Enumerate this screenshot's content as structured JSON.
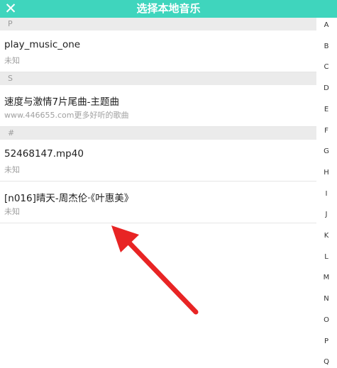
{
  "header": {
    "title": "选择本地音乐",
    "close_icon_glyph": "✕"
  },
  "sections": [
    {
      "letter": "P",
      "items": [
        {
          "title": "play_music_one",
          "subtitle": "未知"
        }
      ]
    },
    {
      "letter": "S",
      "items": [
        {
          "title": "速度与激情7片尾曲-主题曲",
          "subtitle": "www.446655.com更多好听的歌曲"
        }
      ]
    },
    {
      "letter": "#",
      "items": [
        {
          "title": "52468147.mp40",
          "subtitle": "未知"
        },
        {
          "title": "[n016]晴天-周杰伦·《叶惠美》",
          "subtitle": "未知"
        }
      ]
    }
  ],
  "index_letters": [
    "A",
    "B",
    "C",
    "D",
    "E",
    "F",
    "G",
    "H",
    "I",
    "J",
    "K",
    "L",
    "M",
    "N",
    "O",
    "P",
    "Q"
  ],
  "colors": {
    "accent": "#3fd5bd",
    "annotation_arrow": "#e82424"
  }
}
